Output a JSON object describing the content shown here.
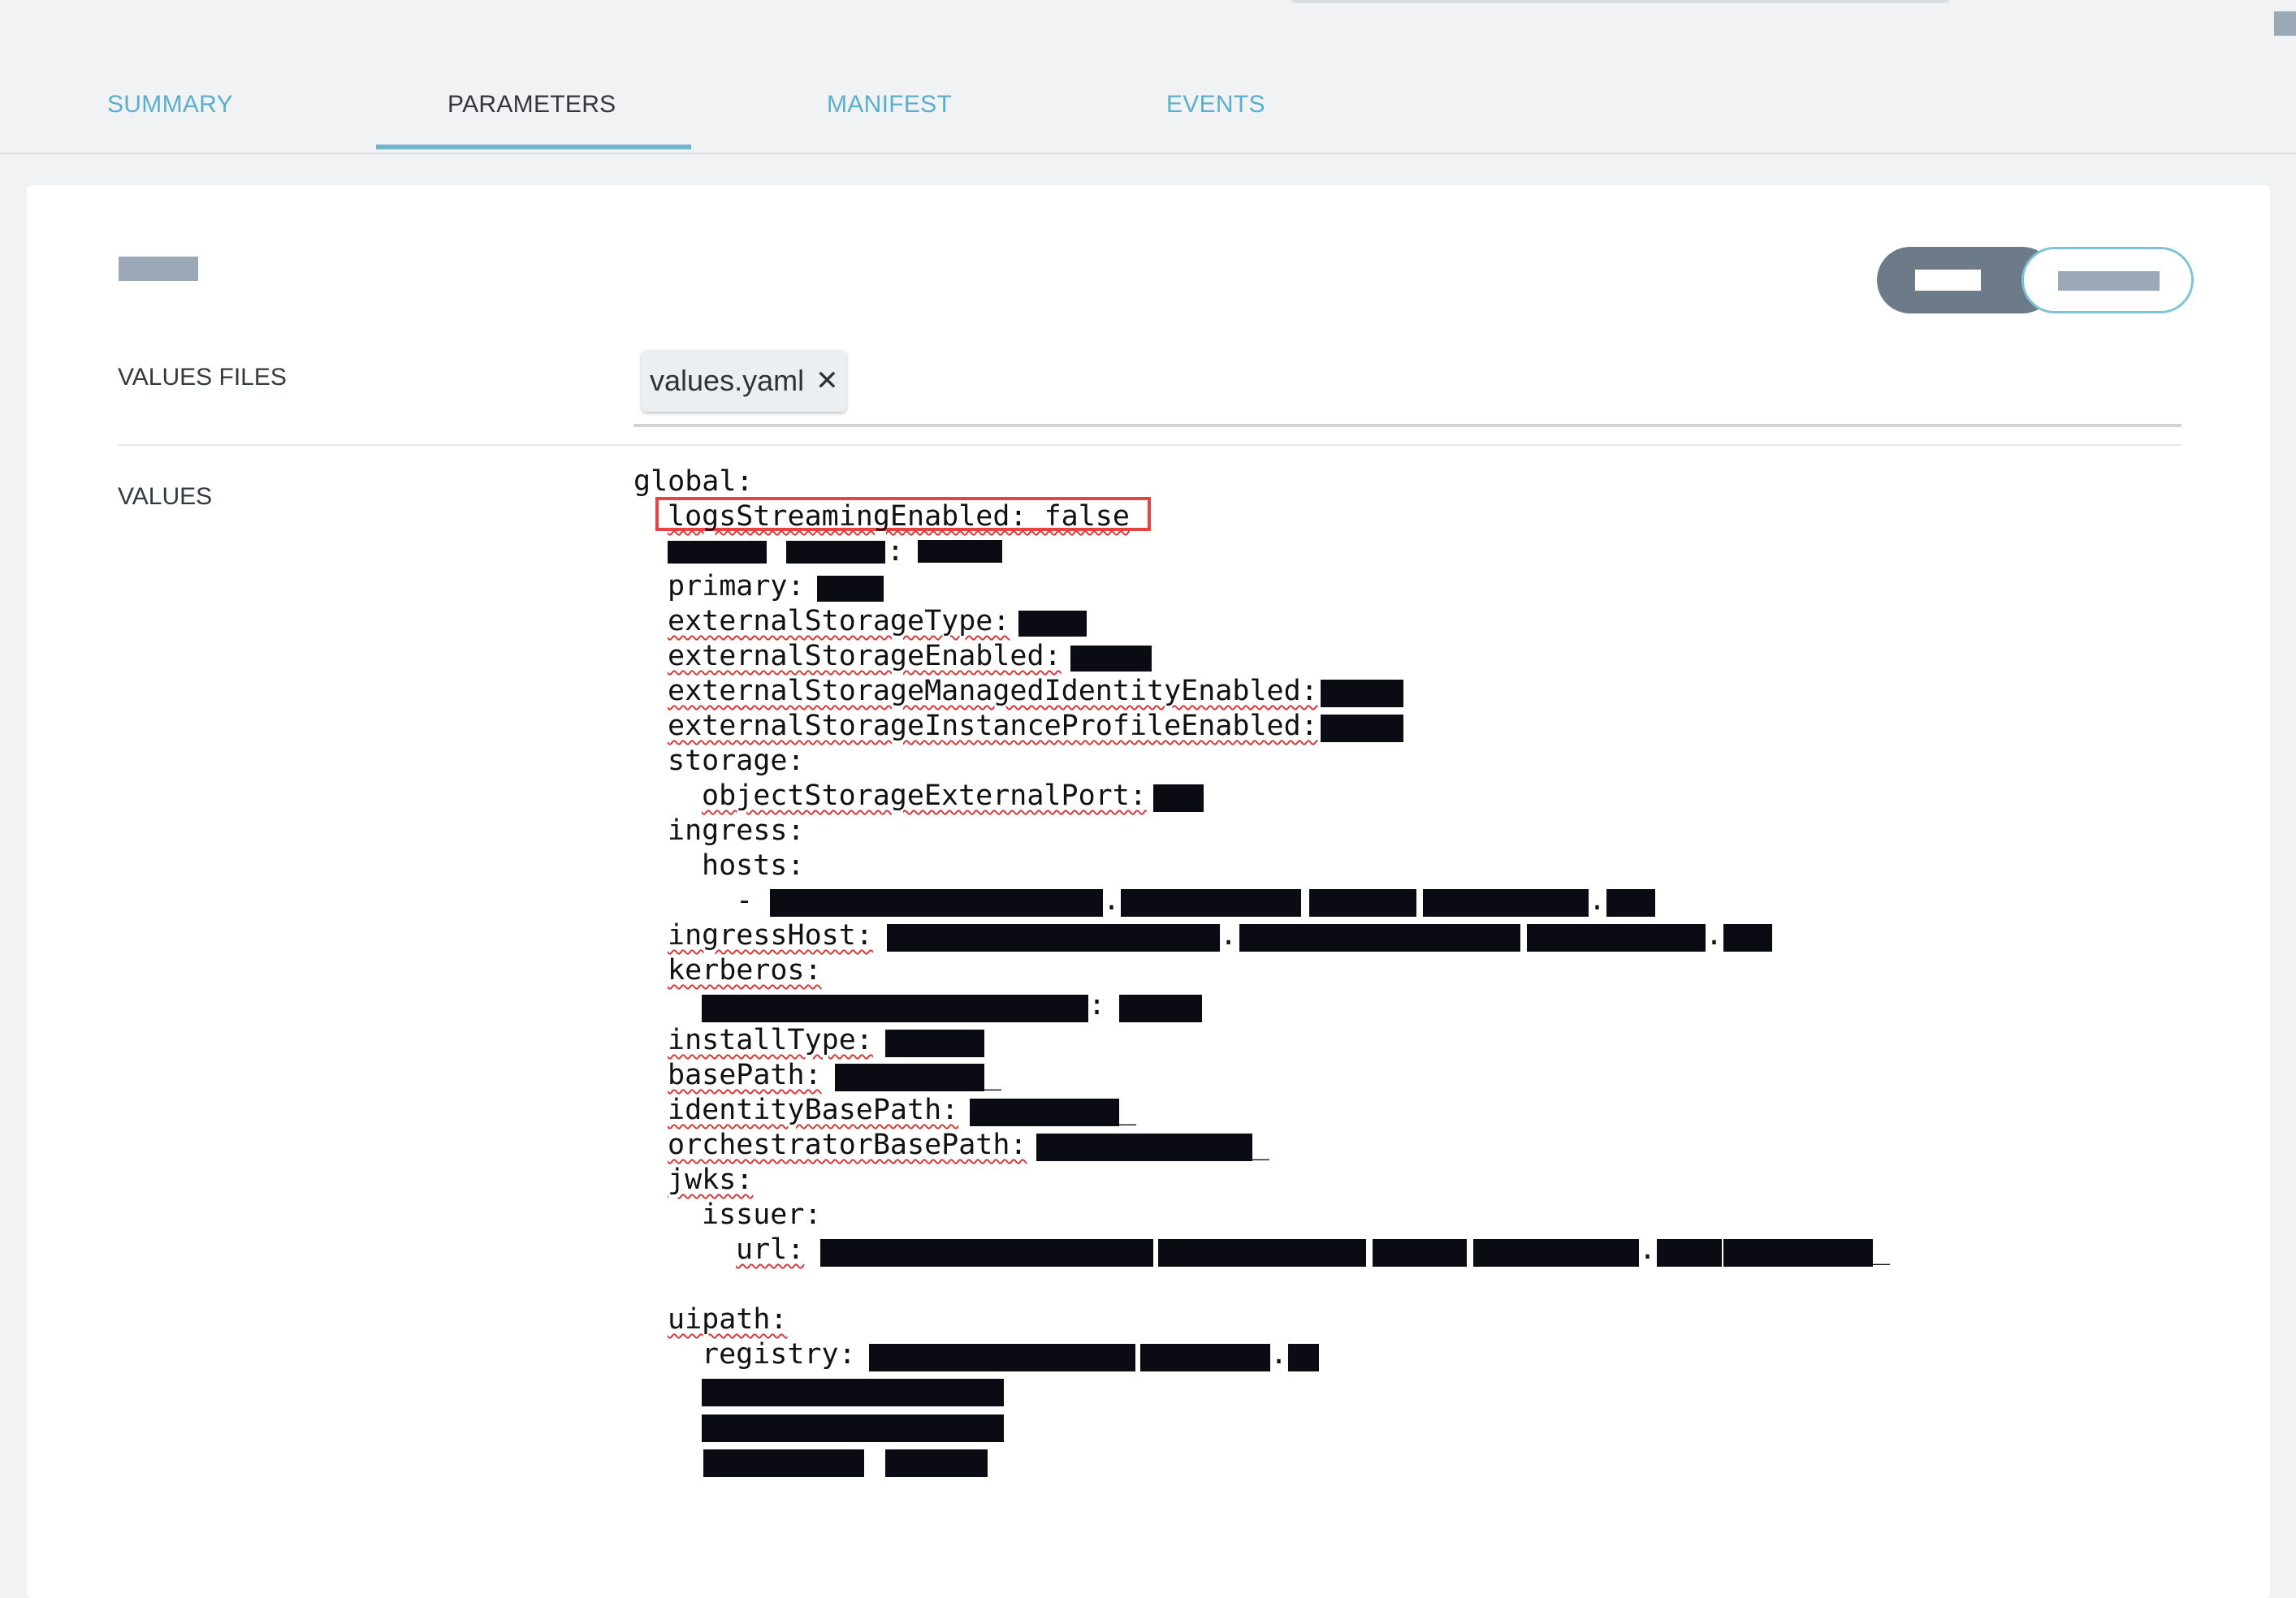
{
  "tabs": [
    {
      "label": "SUMMARY",
      "active": false
    },
    {
      "label": "PARAMETERS",
      "active": true
    },
    {
      "label": "MANIFEST",
      "active": false
    },
    {
      "label": "EVENTS",
      "active": false
    }
  ],
  "values_files": {
    "label": "VALUES FILES",
    "chip_label": "values.yaml",
    "chip_close_icon": "✕"
  },
  "values": {
    "label": "VALUES",
    "lines": {
      "global": "global:",
      "logs": "logsStreamingEnabled: false",
      "primary": "primary:",
      "est": "externalStorageType:",
      "ese": "externalStorageEnabled:",
      "esmie": "externalStorageManagedIdentityEnabled:",
      "esipe": "externalStorageInstanceProfileEnabled:",
      "storage": "storage:",
      "osep": "objectStorageExternalPort:",
      "ingress": "ingress:",
      "hosts": "hosts:",
      "dash": "-",
      "ingressHost": "ingressHost:",
      "kerberos": "kerberos:",
      "installType": "installType:",
      "basePath": "basePath:",
      "identityBasePath": "identityBasePath:",
      "orchestratorBasePath": "orchestratorBasePath:",
      "jwks": "jwks:",
      "issuer": "issuer:",
      "url": "url:",
      "uipath": "uipath:",
      "registry": "registry:",
      "colon": ":",
      "dot": ".",
      "underscore": "_"
    }
  },
  "colors": {
    "accent_tab": "#5ab0cc",
    "active_tab": "#33393f",
    "highlight_border": "#e84343",
    "redaction": "#0b0b14"
  }
}
